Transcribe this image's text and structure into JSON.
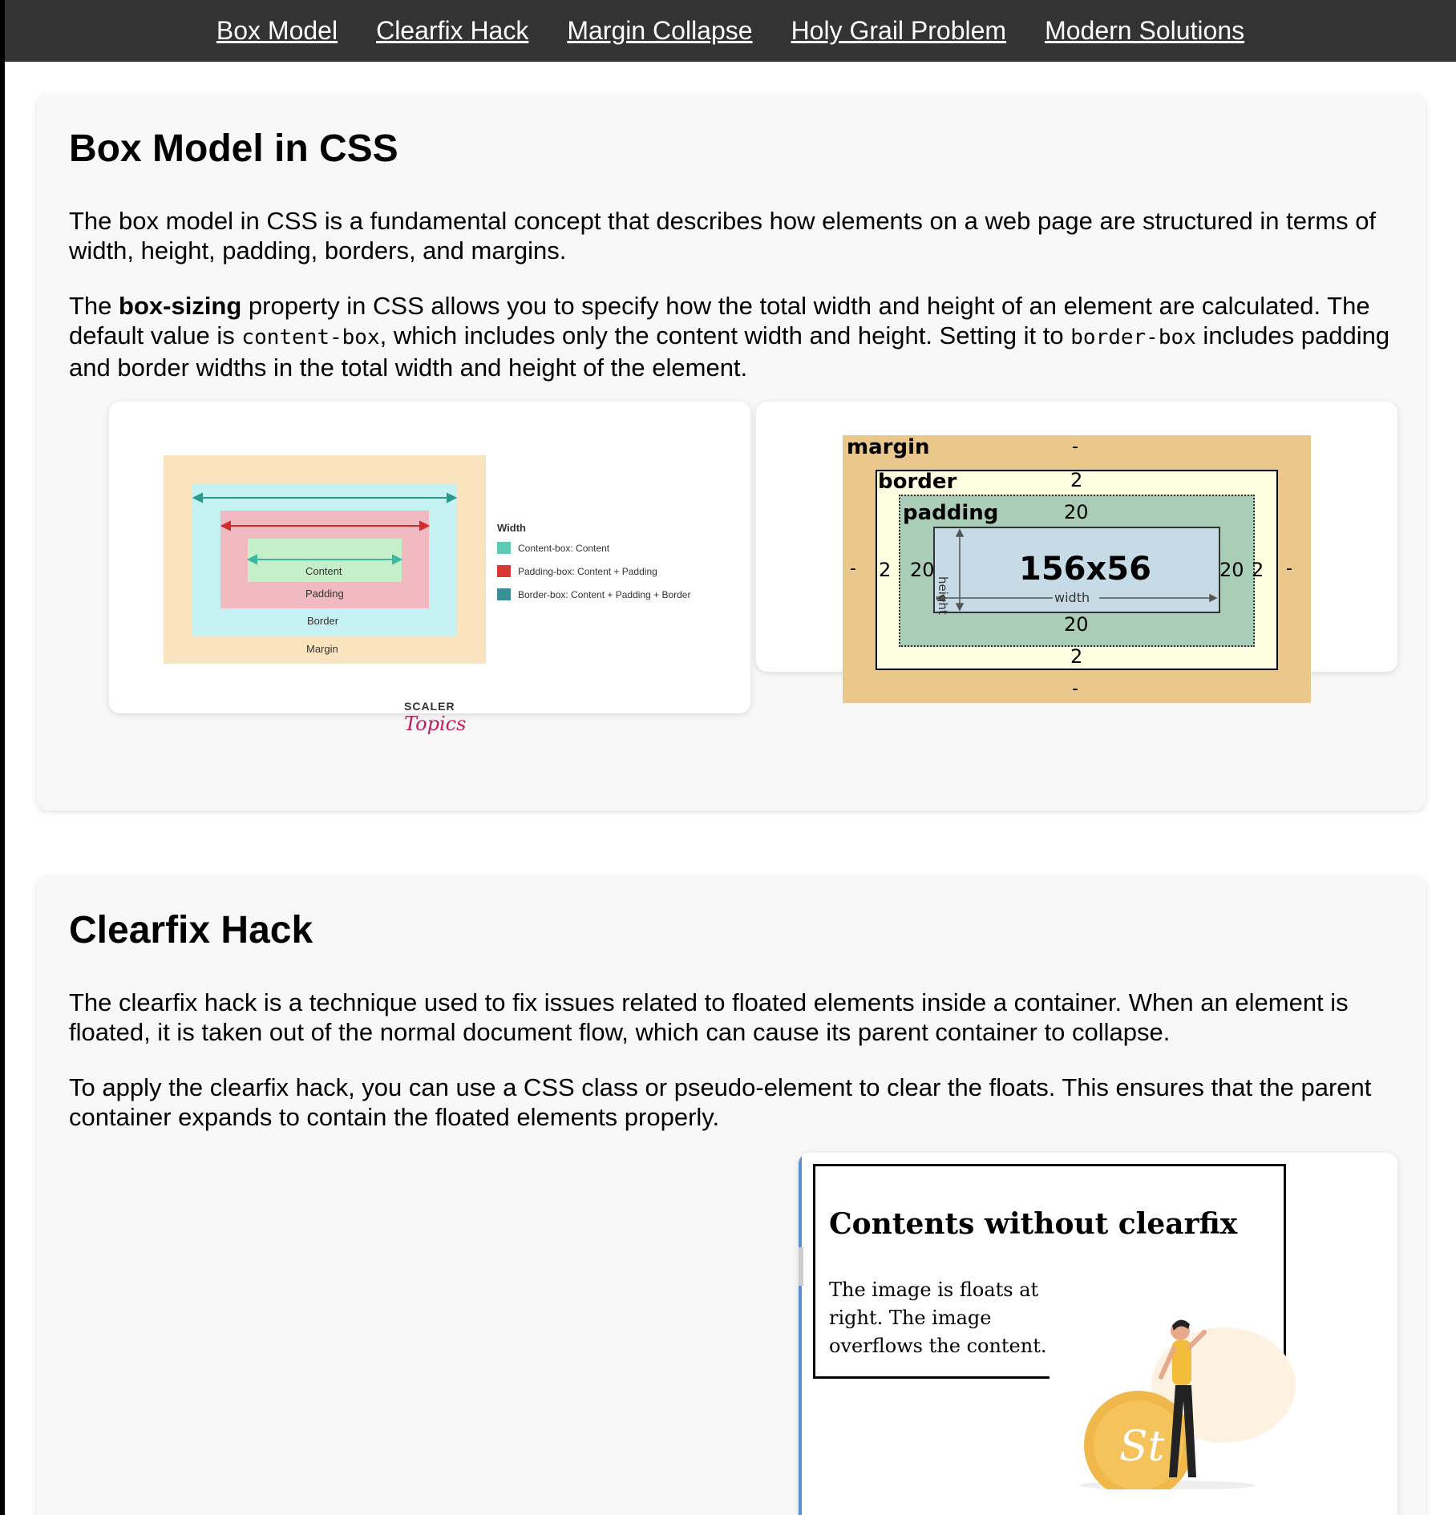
{
  "nav": {
    "items": [
      {
        "label": "Box Model"
      },
      {
        "label": "Clearfix Hack"
      },
      {
        "label": "Margin Collapse"
      },
      {
        "label": "Holy Grail Problem"
      },
      {
        "label": "Modern Solutions"
      }
    ]
  },
  "box_model": {
    "title": "Box Model in CSS",
    "p1": "The box model in CSS is a fundamental concept that describes how elements on a web page are structured in terms of width, height, padding, borders, and margins.",
    "p2_pre": "The ",
    "p2_bold": "box-sizing",
    "p2_mid1": " property in CSS allows you to specify how the total width and height of an element are calculated. The default value is ",
    "p2_code1": "content-box",
    "p2_mid2": ", which includes only the content width and height. Setting it to ",
    "p2_code2": "border-box",
    "p2_end": " includes padding and border widths in the total width and height of the element.",
    "diagram_left": {
      "layers": [
        "Content",
        "Padding",
        "Border",
        "Margin"
      ],
      "legend_title": "Width",
      "legend": [
        {
          "label": "Content-box: Content",
          "color": "#5ec9b4"
        },
        {
          "label": "Padding-box: Content + Padding",
          "color": "#d93636"
        },
        {
          "label": "Border-box: Content + Padding + Border",
          "color": "#3a8f9a"
        }
      ],
      "logo_top": "SCALER",
      "logo_bottom": "Topics"
    },
    "diagram_right": {
      "margin_label": "margin",
      "border_label": "border",
      "padding_label": "padding",
      "size": "156x56",
      "width_label": "width",
      "height_label": "height",
      "margin_value": "-",
      "border_value": "2",
      "padding_value": "20"
    }
  },
  "clearfix": {
    "title": "Clearfix Hack",
    "p1": "The clearfix hack is a technique used to fix issues related to floated elements inside a container. When an element is floated, it is taken out of the normal document flow, which can cause its parent container to collapse.",
    "p2": "To apply the clearfix hack, you can use a CSS class or pseudo-element to clear the floats. This ensures that the parent container expands to contain the floated elements properly.",
    "image": {
      "heading": "Contents without clearfix",
      "text": "The image is floats at right. The image overflows the content.",
      "badge": "St"
    }
  }
}
